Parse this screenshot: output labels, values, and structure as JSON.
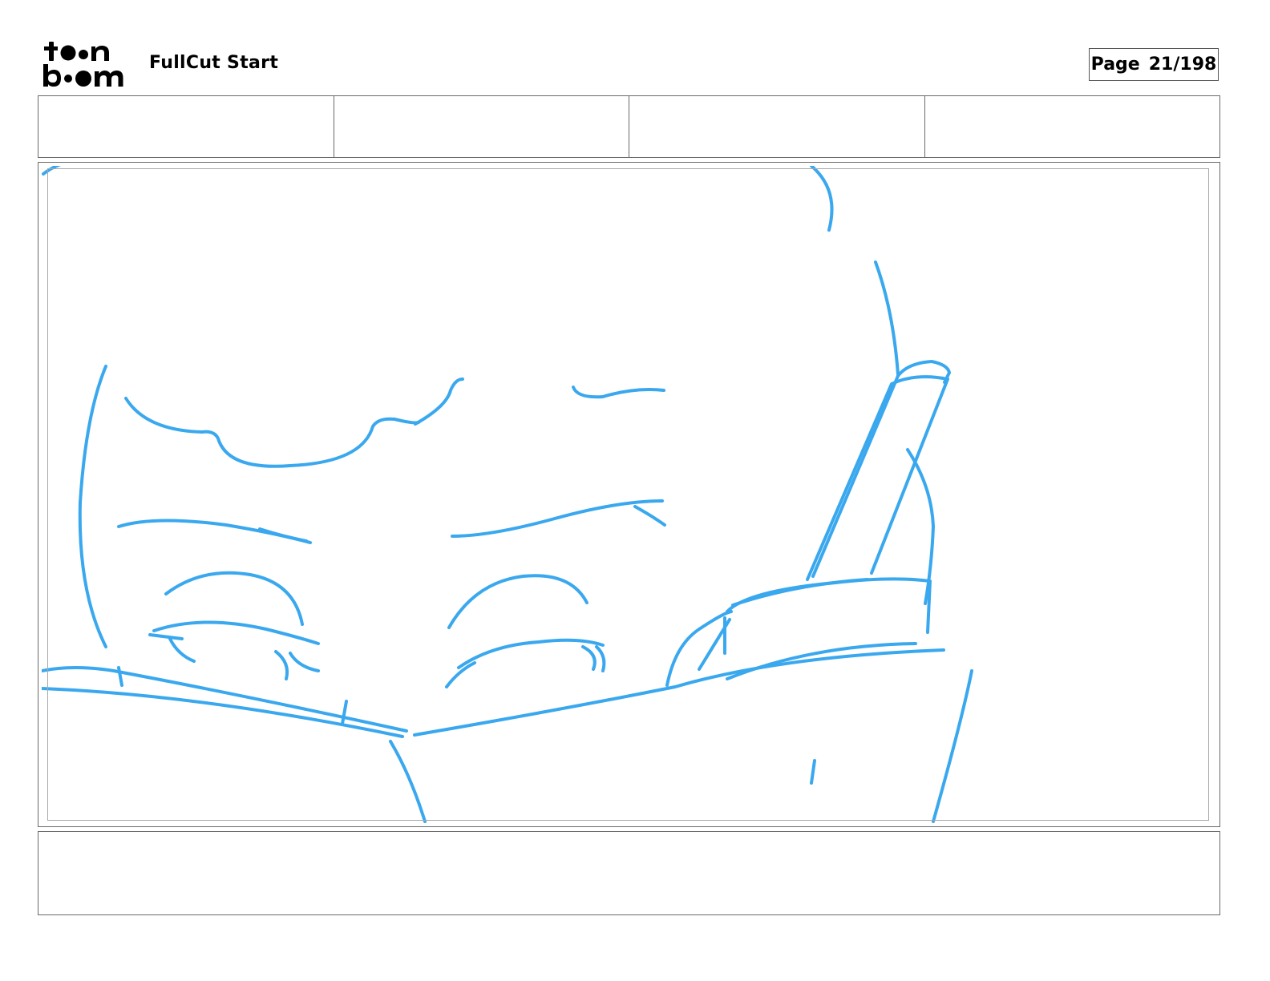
{
  "header": {
    "logo_text": "toonboom",
    "project_title": "FullCut Start",
    "page_label": "Page",
    "page_number": "21/198"
  },
  "info_fields": [
    "",
    "",
    "",
    ""
  ],
  "panel": {
    "image": "storyboard-sketch",
    "sketch_color": "#3aa8ee"
  },
  "caption": ""
}
